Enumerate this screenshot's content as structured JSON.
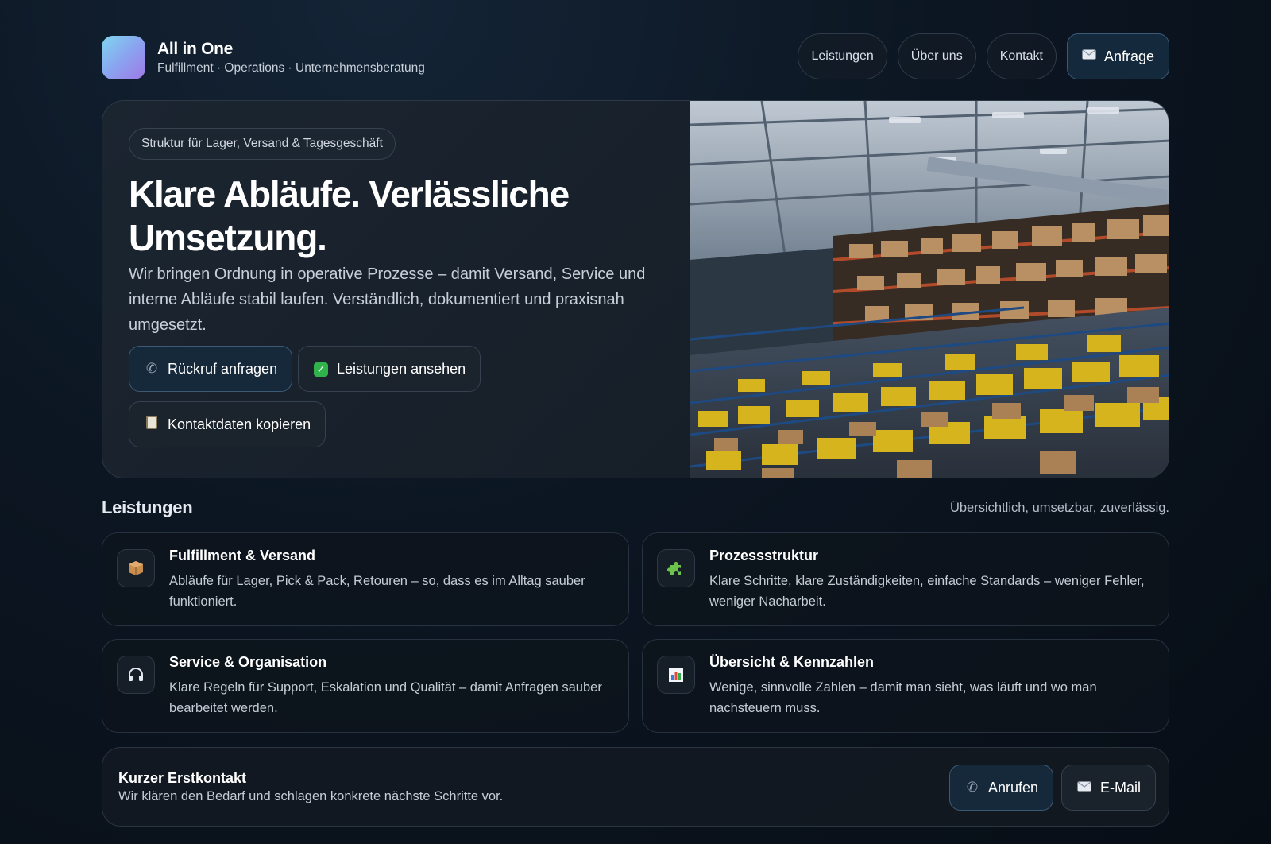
{
  "brand": {
    "name": "All in One",
    "tagline": "Fulfillment · Operations · Unternehmensberatung"
  },
  "nav": {
    "items": [
      {
        "label": "Leistungen"
      },
      {
        "label": "Über uns"
      },
      {
        "label": "Kontakt"
      }
    ],
    "cta_label": "Anfrage",
    "cta_icon": "envelope-icon"
  },
  "hero": {
    "pill": "Struktur für Lager, Versand & Tagesgeschäft",
    "title": "Klare Abläufe. Verlässliche Umsetzung.",
    "text": "Wir bringen Ordnung in operative Prozesse – damit Versand, Service und interne Abläufe stabil laufen. Verständlich, dokumentiert und praxisnah umgesetzt.",
    "buttons": [
      {
        "label": "Rückruf anfragen",
        "icon": "phone-icon"
      },
      {
        "label": "Leistungen ansehen",
        "icon": "check-icon"
      },
      {
        "label": "Kontaktdaten kopieren",
        "icon": "clipboard-icon"
      }
    ],
    "image_alt": "warehouse-photo"
  },
  "services": {
    "title": "Leistungen",
    "subtitle": "Übersichtlich, umsetzbar, zuverlässig.",
    "cards": [
      {
        "title": "Fulfillment & Versand",
        "text": "Abläufe für Lager, Pick & Pack, Retouren – so, dass es im Alltag sauber funktioniert.",
        "icon": "package-icon"
      },
      {
        "title": "Prozessstruktur",
        "text": "Klare Schritte, klare Zuständigkeiten, einfache Standards – weniger Fehler, weniger Nacharbeit.",
        "icon": "puzzle-icon"
      },
      {
        "title": "Service & Organisation",
        "text": "Klare Regeln für Support, Eskalation und Qualität – damit Anfragen sauber bearbeitet werden.",
        "icon": "headphones-icon"
      },
      {
        "title": "Übersicht & Kennzahlen",
        "text": "Wenige, sinnvolle Zahlen – damit man sieht, was läuft und wo man nachsteuern muss.",
        "icon": "bar-chart-icon"
      }
    ]
  },
  "contact": {
    "title": "Kurzer Erstkontakt",
    "text": "Wir klären den Bedarf und schlagen konkrete nächste Schritte vor.",
    "call_label": "Anrufen",
    "email_label": "E-Mail"
  }
}
